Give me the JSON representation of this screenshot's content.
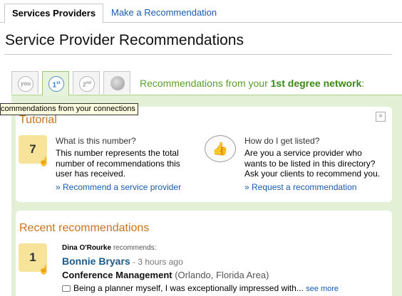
{
  "tabs": {
    "active": "Services Providers",
    "other": "Make a Recommendation"
  },
  "page_title": "Service Provider Recommendations",
  "degree_tabs": {
    "you": "you",
    "first": "1",
    "first_suffix": "st",
    "second": "2",
    "second_suffix": "nd"
  },
  "network_line": {
    "prefix": "Recommendations from your ",
    "emphasis": "1st degree network",
    "suffix": ":"
  },
  "tooltip": "commendations from your connections",
  "tutorial": {
    "heading": "Tutorial",
    "close": "×",
    "badge": "7",
    "left": {
      "title": "What is this number?",
      "body_lines": [
        "This number represents the total",
        "number of recommendations this",
        "user has received."
      ],
      "link": "» Recommend a service provider"
    },
    "right": {
      "title": "How do I get listed?",
      "body_lines": [
        "Are you a service provider who",
        "wants to be listed in this directory?",
        "Ask your clients to recommend you."
      ],
      "link": "» Request a recommendation"
    }
  },
  "recent": {
    "heading": "Recent recommendations",
    "badge": "1",
    "recommender": "Dina O'Rourke",
    "recommends_text": " recommends:",
    "name": "Bonnie Bryars",
    "time": " - 3 hours ago",
    "role": "Conference Management",
    "location": " (Orlando, Florida Area)",
    "quote": "Being a planner myself, I was exceptionally impressed with...",
    "see_more": "see more"
  },
  "colors": {
    "accent_green": "#5a9f2a",
    "heading_orange": "#c8741c",
    "link_blue": "#1a5bad",
    "badge_yellow": "#f7e39a"
  }
}
